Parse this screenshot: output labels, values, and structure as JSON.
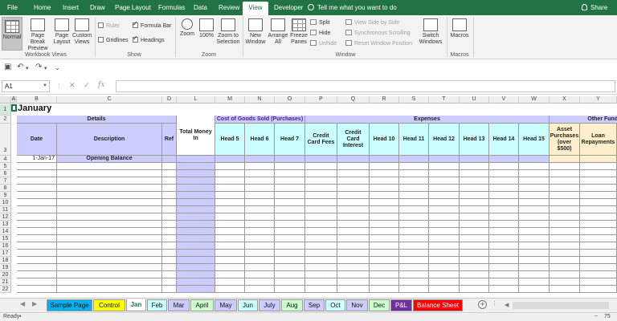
{
  "tabs": [
    "File",
    "Home",
    "Insert",
    "Draw",
    "Page Layout",
    "Formulas",
    "Data",
    "Review",
    "View",
    "Developer"
  ],
  "active_tab": "View",
  "tell_me": "Tell me what you want to do",
  "share": "Share",
  "ribbon": {
    "normal": "Normal",
    "page_break_1": "Page Break",
    "page_break_2": "Preview",
    "page_layout_1": "Page",
    "page_layout_2": "Layout",
    "custom_views_1": "Custom",
    "custom_views_2": "Views",
    "workbook_views": "Workbook Views",
    "ruler": "Ruler",
    "formula_bar": "Formula Bar",
    "gridlines": "Gridlines",
    "headings": "Headings",
    "show": "Show",
    "zoom": "Zoom",
    "zoom_100": "100%",
    "zoom_sel_1": "Zoom to",
    "zoom_sel_2": "Selection",
    "zoom_group": "Zoom",
    "new_window_1": "New",
    "new_window_2": "Window",
    "arrange_1": "Arrange",
    "arrange_2": "All",
    "freeze_1": "Freeze",
    "freeze_2": "Panes",
    "split": "Split",
    "hide": "Hide",
    "unhide": "Unhide",
    "side_by_side": "View Side by Side",
    "sync_scroll": "Synchronous Scrolling",
    "reset_pos": "Reset Window Position",
    "switch_1": "Switch",
    "switch_2": "Windows",
    "window_group": "Window",
    "macros": "Macros",
    "macros_group": "Macros"
  },
  "name_box": "A1",
  "columns": [
    "A",
    "B",
    "C",
    "D",
    "L",
    "M",
    "N",
    "O",
    "P",
    "Q",
    "R",
    "S",
    "T",
    "U",
    "V",
    "W",
    "X",
    "Y"
  ],
  "rows": [
    "1",
    "2",
    "3",
    "4",
    "5",
    "6",
    "7",
    "8",
    "9",
    "10",
    "11",
    "12",
    "13",
    "14",
    "15",
    "16",
    "17",
    "18",
    "19",
    "20",
    "21",
    "22"
  ],
  "sheet": {
    "title": "January",
    "details": "Details",
    "cogs": "Cost of Goods Sold (Purchases)",
    "expenses": "Expenses",
    "other_funds": "Other Funds",
    "date": "Date",
    "description": "Description",
    "ref": "Ref",
    "total_money_in": "Total Money In",
    "head5": "Head 5",
    "head6": "Head 6",
    "head7": "Head 7",
    "cc_fees": "Credit Card Fees",
    "cc_interest": "Credit Card Interest",
    "head10": "Head 10",
    "head11": "Head 11",
    "head12": "Head 12",
    "head13": "Head 13",
    "head14": "Head 14",
    "head15": "Head 15",
    "asset": "Asset Purchases (over $500)",
    "loan": "Loan Repayments",
    "row4_date": "1-Jan-17",
    "row4_desc": "Opening Balance"
  },
  "sheet_tabs": [
    {
      "label": "Sample Page",
      "color": "#00b0f0"
    },
    {
      "label": "Control",
      "color": "#ffff00"
    },
    {
      "label": "Jan",
      "color": "#ffffff"
    },
    {
      "label": "Feb",
      "color": "#ccffff"
    },
    {
      "label": "Mar",
      "color": "#ccccff"
    },
    {
      "label": "April",
      "color": "#ccffcc"
    },
    {
      "label": "May",
      "color": "#ccccff"
    },
    {
      "label": "Jun",
      "color": "#ccffff"
    },
    {
      "label": "July",
      "color": "#ccccff"
    },
    {
      "label": "Aug",
      "color": "#ccffcc"
    },
    {
      "label": "Sep",
      "color": "#ccccff"
    },
    {
      "label": "Oct",
      "color": "#ccffff"
    },
    {
      "label": "Nov",
      "color": "#ccccff"
    },
    {
      "label": "Dec",
      "color": "#ccffcc"
    },
    {
      "label": "P&L",
      "color": "#7030a0"
    },
    {
      "label": "Balance Sheet",
      "color": "#ff0000"
    }
  ],
  "status_ready": "Ready",
  "zoom_value": "75"
}
